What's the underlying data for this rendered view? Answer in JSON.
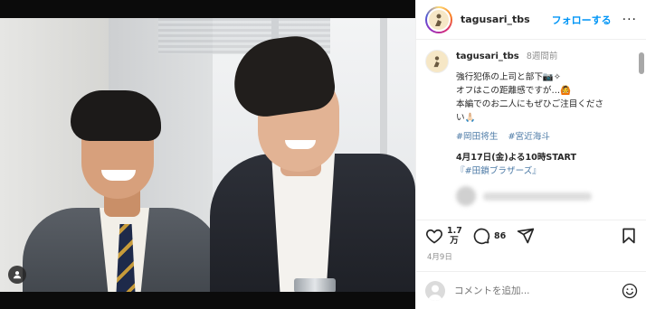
{
  "header": {
    "username": "tagusari_tbs",
    "follow_label": "フォローする",
    "more_label": "···"
  },
  "caption": {
    "username": "tagusari_tbs",
    "time": "8週間前",
    "text": "強行犯係の上司と部下📷✧\nオフはこの距離感ですが…🙆\n本編でのお二人にもぜひご注目くださ\nい🙏🏻",
    "hashtags": [
      "#岡田将生",
      "#宮近海斗"
    ],
    "start_text": "4月17日(金)よる10時START",
    "start_tag": "『#田鎖ブラザーズ』"
  },
  "actions": {
    "likes_line1": "1.7",
    "likes_line2": "万",
    "comments_count": "86"
  },
  "post_date": "4月9日",
  "comment_box": {
    "placeholder": "コメントを追加..."
  },
  "colors": {
    "accent": "#0095f6",
    "hashtag": "#4c7aa6",
    "secondary_text": "#8e8e8e"
  }
}
